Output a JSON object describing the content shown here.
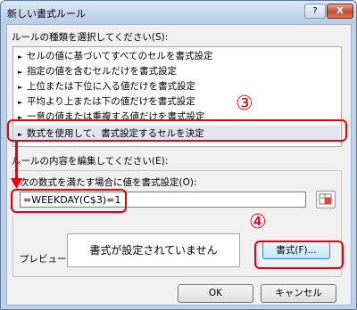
{
  "window": {
    "title": "新しい書式ルール",
    "help_glyph": "?",
    "close_glyph": "X"
  },
  "rule_type": {
    "label": "ルールの種類を選択してください(S):",
    "arrow": "►",
    "items": [
      "セルの値に基づいてすべてのセルを書式設定",
      "指定の値を含むセルだけを書式設定",
      "上位または下位に入る値だけを書式設定",
      "平均より上または下の値だけを書式設定",
      "一意の値または重複する値だけを書式設定",
      "数式を使用して、書式設定するセルを決定"
    ],
    "selected_index": 5
  },
  "rule_content": {
    "label": "ルールの内容を編集してください(E):",
    "formula_label": "次の数式を満たす場合に値を書式設定(O):",
    "formula_value": "=WEEKDAY(C$3)=1",
    "preview_label": "プレビュー:",
    "preview_text": "書式が設定されていません",
    "format_button": "書式(F)..."
  },
  "footer": {
    "ok": "OK",
    "cancel": "キャンセル"
  },
  "annotations": {
    "step3": "③",
    "step4": "④",
    "color": "#e60012"
  }
}
